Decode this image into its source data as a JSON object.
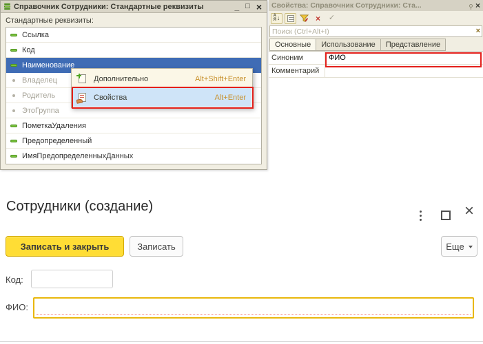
{
  "glyphs": {
    "minimize": "_",
    "maximize": "□",
    "close": "×",
    "check": "✓",
    "cancel": "×",
    "search_clear": "×",
    "sort_a": "А",
    "sort_z": "Я",
    "sort_arrow": "↓"
  },
  "std_attrs_window": {
    "title": "Справочник Сотрудники: Стандартные реквизиты",
    "label": "Стандартные реквизиты:",
    "items": [
      {
        "name": "Ссылка"
      },
      {
        "name": "Код"
      },
      {
        "name": "Наименование"
      },
      {
        "name": "Владелец"
      },
      {
        "name": "Родитель"
      },
      {
        "name": "ЭтоГруппа"
      },
      {
        "name": "ПометкаУдаления"
      },
      {
        "name": "Предопределенный"
      },
      {
        "name": "ИмяПредопределенныхДанных"
      }
    ],
    "selected_item": "Наименование",
    "disabled_items": [
      "Владелец",
      "Родитель",
      "ЭтоГруппа"
    ]
  },
  "context_menu": {
    "items": [
      {
        "label": "Дополнительно",
        "shortcut": "Alt+Shift+Enter"
      },
      {
        "label": "Свойства",
        "shortcut": "Alt+Enter"
      }
    ],
    "highlighted_item": "Свойства"
  },
  "properties_panel": {
    "title": "Свойства: Справочник Сотрудники: Ста...",
    "search_placeholder": "Поиск (Ctrl+Alt+I)",
    "tabs": [
      {
        "label": "Основные"
      },
      {
        "label": "Использование"
      },
      {
        "label": "Представление"
      }
    ],
    "active_tab": "Основные",
    "fields": [
      {
        "label": "Синоним",
        "value": "ФИО"
      },
      {
        "label": "Комментарий",
        "value": ""
      }
    ]
  },
  "form": {
    "title": "Сотрудники (создание)",
    "buttons": [
      {
        "label": "Записать и закрыть"
      },
      {
        "label": "Записать"
      },
      {
        "label": "Еще"
      }
    ],
    "fields": [
      {
        "label": "Код:",
        "value": ""
      },
      {
        "label": "ФИО:",
        "value": ""
      }
    ]
  },
  "colors": {
    "selection_blue": "#3f6cb5",
    "menu_highlight_blue": "#cfe4f8",
    "annotation_red": "#e3201b",
    "primary_button_yellow": "#ffdd35",
    "focused_input_border": "#e9b70c",
    "required_underline_red": "#f49090",
    "shortcut_text_orange": "#c8922f",
    "catalog_icon_green": "#79c13d",
    "panel_background": "#f1eee2"
  }
}
